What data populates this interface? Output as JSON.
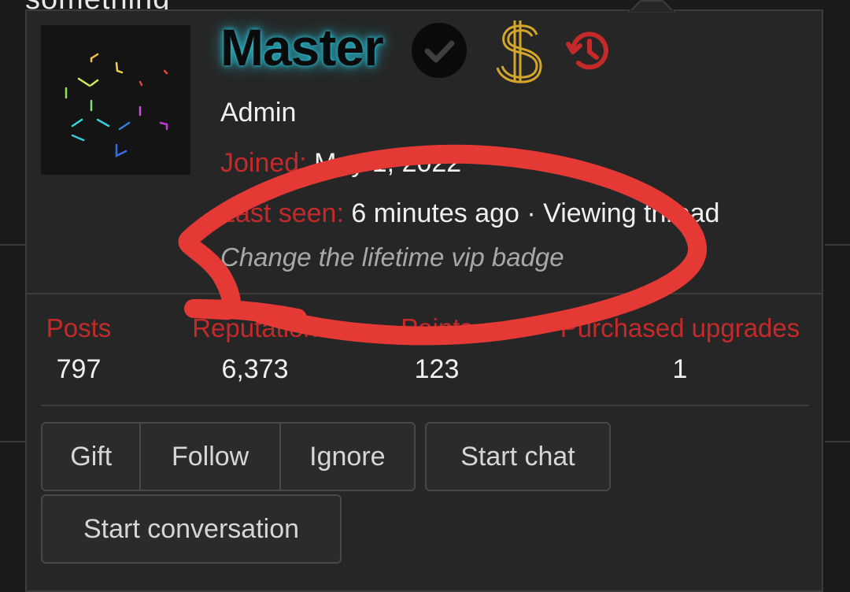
{
  "background": {
    "partial_text": "something"
  },
  "profile": {
    "username": "Master",
    "username_glow_color": "#29b6c8",
    "role": "Admin",
    "badges": [
      "check-circle-icon",
      "dollar-icon",
      "history-icon"
    ],
    "joined_label": "Joined:",
    "joined_value": "May 1, 2022",
    "last_seen_label": "Last seen:",
    "last_seen_value": "6 minutes ago · Viewing thread",
    "status_message": "Change the lifetime vip badge"
  },
  "stats": [
    {
      "label": "Posts",
      "value": "797"
    },
    {
      "label": "Reputation",
      "value": "6,373"
    },
    {
      "label": "Points",
      "value": "123"
    },
    {
      "label": "Purchased upgrades",
      "value": "1"
    }
  ],
  "actions": {
    "gift": "Gift",
    "follow": "Follow",
    "ignore": "Ignore",
    "start_chat": "Start chat",
    "start_conversation": "Start conversation"
  },
  "colors": {
    "accent_red": "#c52a2a",
    "annotation_red": "#e53935",
    "badge_gold": "#d4a72c",
    "panel_bg": "#262626"
  }
}
